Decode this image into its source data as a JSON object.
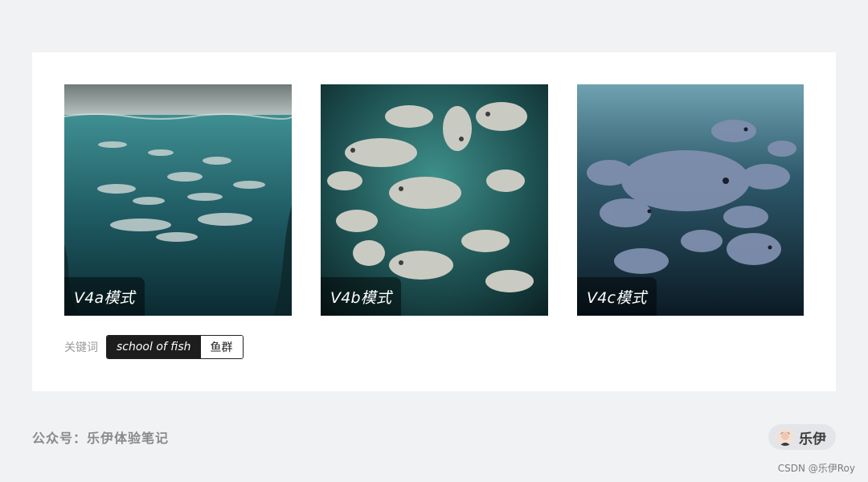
{
  "gallery": {
    "items": [
      {
        "label": "V4a模式",
        "image": "school-of-fish-v4a"
      },
      {
        "label": "V4b模式",
        "image": "school-of-fish-v4b"
      },
      {
        "label": "V4c模式",
        "image": "school-of-fish-v4c"
      }
    ]
  },
  "keywords": {
    "label": "关键词",
    "english": "school of fish",
    "chinese": "鱼群"
  },
  "footer": {
    "account": "公众号：乐伊体验笔记",
    "author": "乐伊",
    "avatar_icon": "avatar-icon"
  },
  "watermark": "CSDN @乐伊Roy",
  "colors": {
    "page_bg": "#f1f2f4",
    "card_bg": "#ffffff",
    "pill_dark": "#1d1d1d"
  }
}
